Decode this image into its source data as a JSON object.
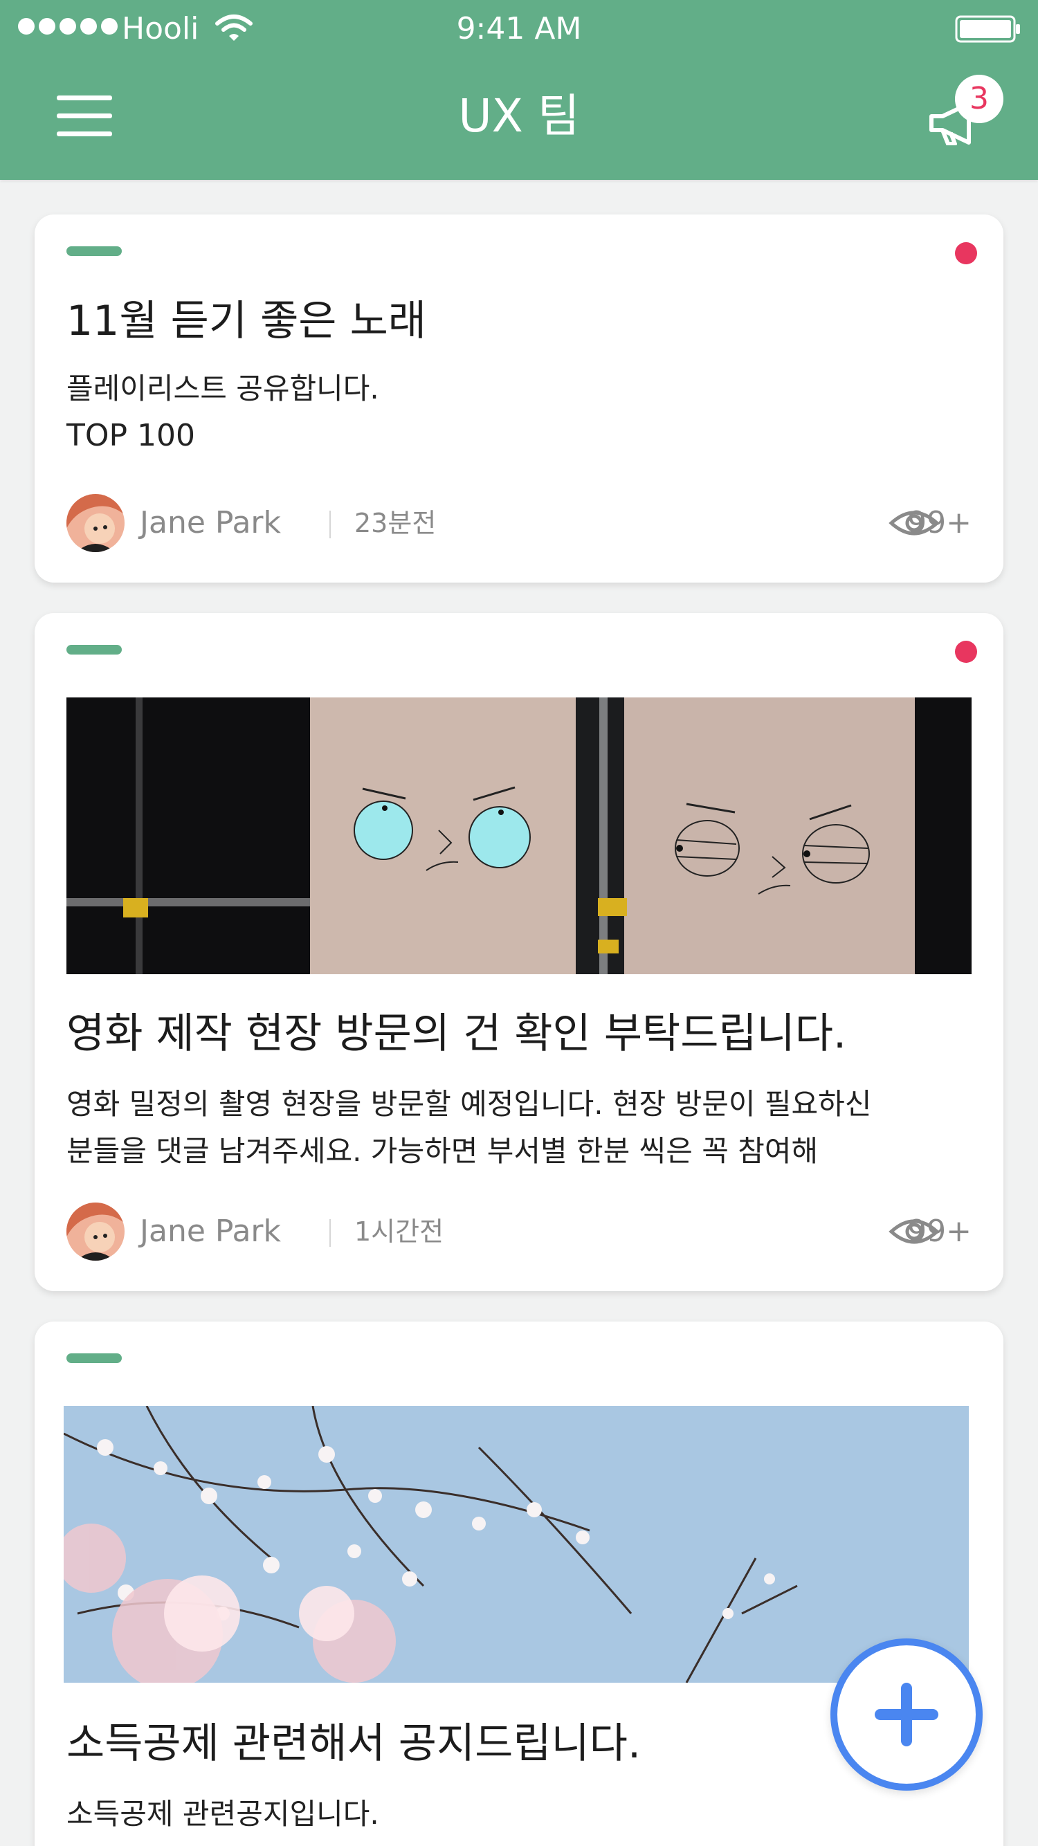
{
  "status_bar": {
    "carrier": "Hooli",
    "time": "9:41 AM",
    "signal_icon": "signal-dots-icon",
    "wifi_icon": "wifi-icon",
    "battery_icon": "battery-icon"
  },
  "nav": {
    "title": "UX 팀",
    "menu_icon": "hamburger-menu-icon",
    "announce_icon": "megaphone-icon",
    "notification_count": "3"
  },
  "colors": {
    "brand_green": "#62ae88",
    "unread_dot": "#e8365f",
    "fab_blue": "#4a86f0"
  },
  "posts": [
    {
      "title": "11월 듣기 좋은 노래",
      "body_lines": [
        "플레이리스트 공유합니다.",
        "TOP 100"
      ],
      "author": "Jane Park",
      "time": "23분전",
      "views": "99+",
      "unread": true
    },
    {
      "title": "영화 제작 현장 방문의 건 확인 부탁드립니다.",
      "body_lines": [
        "영화 밀정의 촬영 현장을 방문할 예정입니다. 현장 방문이 필요하신",
        "분들을 댓글 남겨주세요. 가능하면 부서별 한분 씩은 꼭 참여해"
      ],
      "author": "Jane Park",
      "time": "1시간전",
      "views": "99+",
      "unread": true
    },
    {
      "title": "소득공제 관련해서 공지드립니다.",
      "body_lines": [
        "소득공제 관련공지입니다."
      ],
      "unread": false
    }
  ],
  "fab": {
    "icon": "plus-icon"
  }
}
